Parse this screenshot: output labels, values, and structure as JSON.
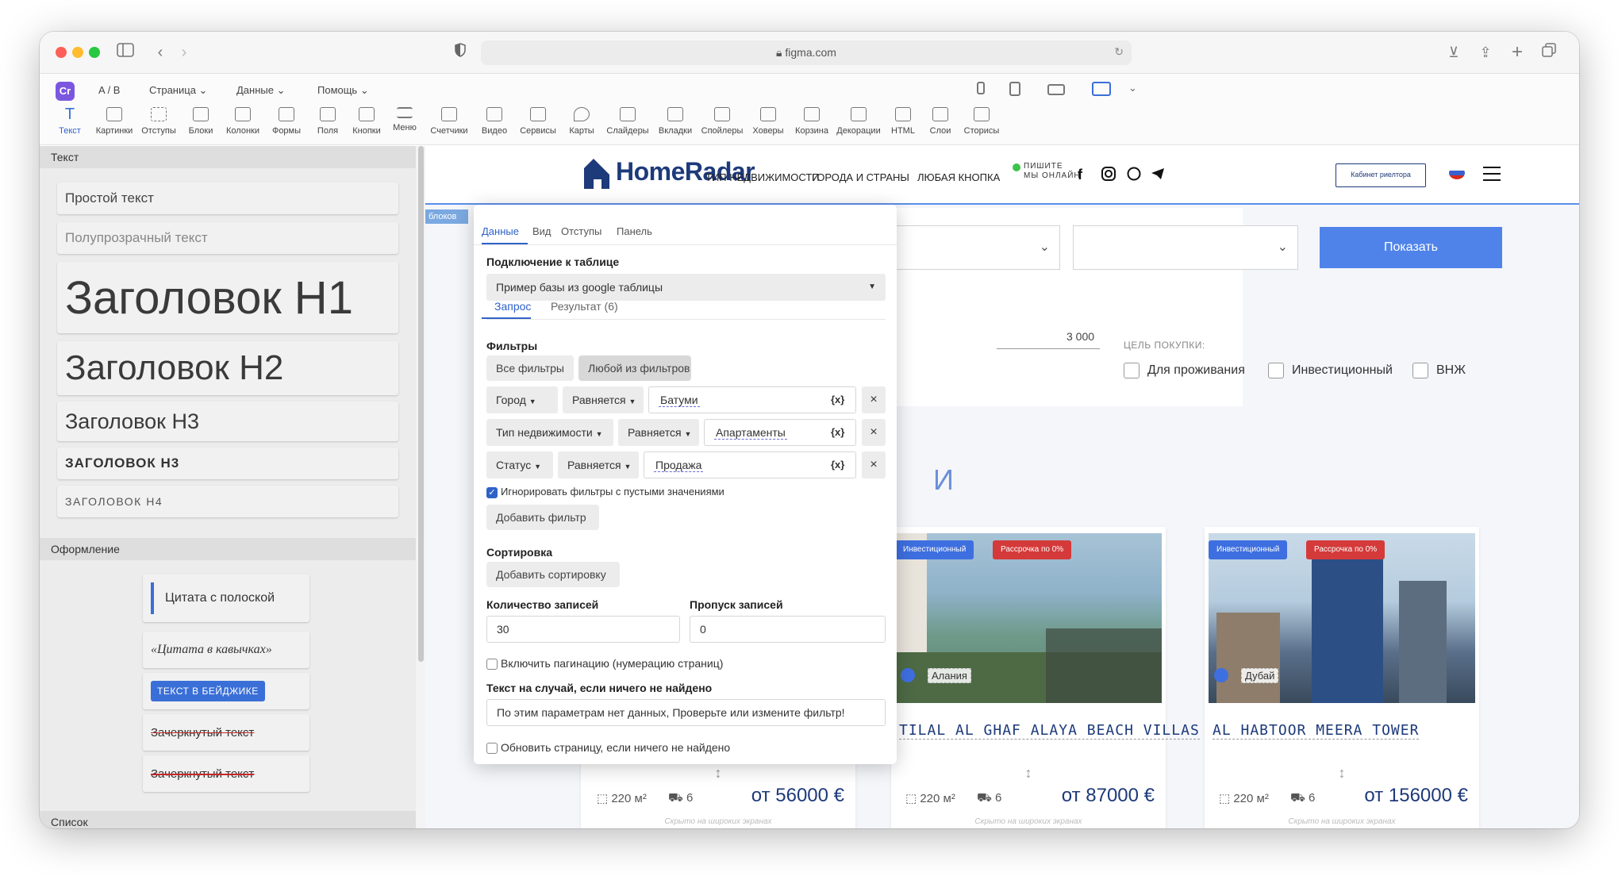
{
  "browser": {
    "url": "figma.com"
  },
  "app": {
    "logo": "Cr",
    "menu": [
      {
        "label": "A / B"
      },
      {
        "label": "Страница"
      },
      {
        "label": "Данные"
      },
      {
        "label": "Помощь"
      }
    ],
    "tools": [
      {
        "label": "Текст",
        "icon": "text-icon"
      },
      {
        "label": "Картинки",
        "icon": "image-icon"
      },
      {
        "label": "Отступы",
        "icon": "padding-icon"
      },
      {
        "label": "Блоки",
        "icon": "block-icon"
      },
      {
        "label": "Колонки",
        "icon": "columns-icon"
      },
      {
        "label": "Формы",
        "icon": "form-icon"
      },
      {
        "label": "Поля",
        "icon": "field-icon"
      },
      {
        "label": "Кнопки",
        "icon": "button-icon"
      },
      {
        "label": "Меню",
        "icon": "menu-icon"
      },
      {
        "label": "Счетчики",
        "icon": "counter-icon"
      },
      {
        "label": "Видео",
        "icon": "video-icon"
      },
      {
        "label": "Сервисы",
        "icon": "services-icon"
      },
      {
        "label": "Карты",
        "icon": "map-icon"
      },
      {
        "label": "Слайдеры",
        "icon": "slider-icon"
      },
      {
        "label": "Вкладки",
        "icon": "tabs-icon"
      },
      {
        "label": "Спойлеры",
        "icon": "spoiler-icon"
      },
      {
        "label": "Ховеры",
        "icon": "hover-icon"
      },
      {
        "label": "Корзина",
        "icon": "cart-icon"
      },
      {
        "label": "Декорации",
        "icon": "decor-icon"
      },
      {
        "label": "HTML",
        "icon": "html-icon"
      },
      {
        "label": "Слои",
        "icon": "layers-icon"
      },
      {
        "label": "Сторисы",
        "icon": "stories-icon"
      }
    ]
  },
  "left_panel": {
    "section_text": "Текст",
    "blocks": [
      {
        "label": "Простой текст"
      },
      {
        "label": "Полупрозрачный текст"
      },
      {
        "label": "Заголовок H1"
      },
      {
        "label": "Заголовок H2"
      },
      {
        "label": "Заголовок H3"
      },
      {
        "label": "ЗАГОЛОВОК Н3"
      },
      {
        "label": "ЗАГОЛОВОК Н4"
      }
    ],
    "section_design": "Оформление",
    "design_blocks": [
      {
        "label": "Цитата с полоской"
      },
      {
        "label": "«Цитата в кавычках»"
      },
      {
        "label": "ТЕКСТ В БЕЙДЖИКЕ"
      },
      {
        "label": "Зачеркнутый текст"
      },
      {
        "label": "Зачеркнутый текст"
      }
    ],
    "section_list": "Список"
  },
  "site": {
    "brand": "HomeRadar",
    "nav": [
      "ТИП НЕДВИЖИМОСТИ",
      "ГОРОДА И СТРАНЫ",
      "ЛЮБАЯ КНОПКА"
    ],
    "write_online": [
      "ПИШИТЕ",
      "МЫ ОНЛАЙН"
    ],
    "cabinet": "Кабинет риелтора",
    "block_tag": "блоков",
    "show_button": "Показать",
    "price_value": "3 000",
    "purpose_label": "ЦЕЛЬ ПОКУПКИ:",
    "purpose_options": [
      "Для проживания",
      "Инвестиционный",
      "ВНЖ"
    ],
    "heading_fragment": "И",
    "cards": [
      {
        "badge_invest": "",
        "badge_installment": "",
        "location": "",
        "title": "",
        "area": "220 м²",
        "parking": "6",
        "price": "от 56000 €",
        "hidden": "Скрыто на широких экранах"
      },
      {
        "badge_invest": "Инвестиционный",
        "badge_installment": "Рассрочка по 0%",
        "location": "Алания",
        "title": "TILAL AL GHAF ALAYA BEACH VILLAS",
        "area": "220 м²",
        "parking": "6",
        "price": "от 87000 €",
        "hidden": "Скрыто на широких экранах"
      },
      {
        "badge_invest": "Инвестиционный",
        "badge_installment": "Рассрочка по 0%",
        "location": "Дубай",
        "title": "AL HABTOOR MEERA TOWER",
        "area": "220 м²",
        "parking": "6",
        "price": "от 156000 €",
        "hidden": "Скрыто на широких экранах"
      }
    ]
  },
  "popup": {
    "tabs": [
      "Данные",
      "Вид",
      "Отступы",
      "Панель"
    ],
    "connection_label": "Подключение к таблице",
    "connection_value": "Пример базы из google таблицы",
    "subtabs": [
      "Запрос",
      "Результат (6)"
    ],
    "filters_label": "Фильтры",
    "filter_mode": [
      "Все фильтры",
      "Любой из фильтров"
    ],
    "filters": [
      {
        "field": "Город",
        "op": "Равняется",
        "value": "Батуми"
      },
      {
        "field": "Тип недвижимости",
        "op": "Равняется",
        "value": "Апартаменты"
      },
      {
        "field": "Статус",
        "op": "Равняется",
        "value": "Продажа"
      }
    ],
    "var_token": "{x}",
    "remove_glyph": "×",
    "ignore_empty": "Игнорировать фильтры с пустыми значениями",
    "add_filter": "Добавить фильтр",
    "sort_label": "Сортировка",
    "add_sort": "Добавить сортировку",
    "count_label": "Количество записей",
    "count_value": "30",
    "skip_label": "Пропуск записей",
    "skip_value": "0",
    "pagination": "Включить пагинацию (нумерацию страниц)",
    "not_found_label": "Текст на случай, если ничего не найдено",
    "not_found_value": "По этим параметрам нет данных, Проверьте или измените фильтр!",
    "refresh": "Обновить страницу, если ничего не найдено"
  }
}
